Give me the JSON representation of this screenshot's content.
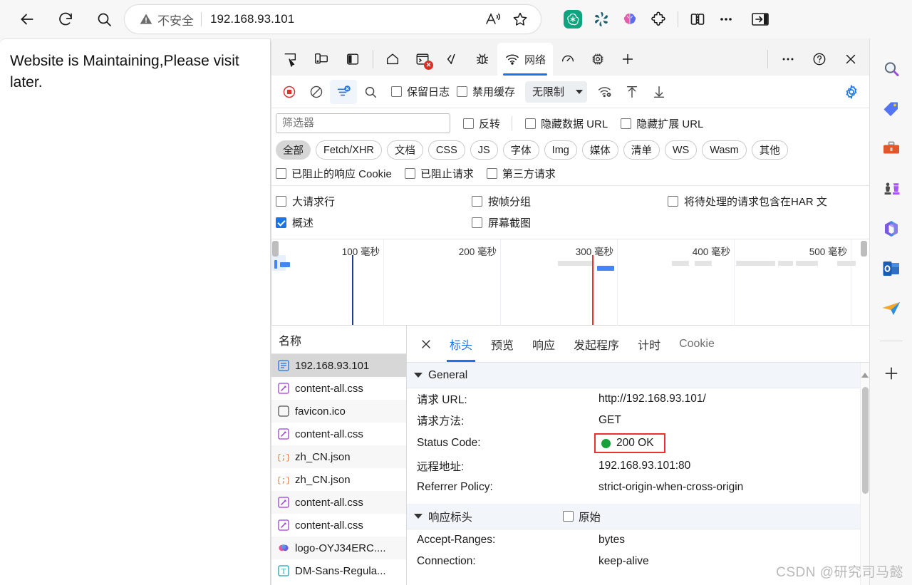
{
  "browser": {
    "nav": {
      "back": "back-arrow",
      "reload": "reload",
      "search": "search"
    },
    "omnibox": {
      "warning_label": "不安全",
      "url": "192.168.93.101",
      "read_aloud": "read-aloud",
      "favorite": "favorite-star"
    },
    "extensions": [
      "chatgpt",
      "openai",
      "brain-ai",
      "extensions-puzzle",
      "split-screen",
      "more-options",
      "collections-open"
    ]
  },
  "page": {
    "text": "Website is Maintaining,Please visit later."
  },
  "devtools": {
    "tools": [
      "inspect-element",
      "device-toolbar",
      "dock-side"
    ],
    "tabs": [
      {
        "label": "",
        "icon": "home-icon",
        "active": false
      },
      {
        "label": "",
        "icon": "console-icon",
        "active": false,
        "error_badge": "x"
      },
      {
        "label": "",
        "icon": "sources-icon",
        "active": false
      },
      {
        "label": "",
        "icon": "elements-bug-icon",
        "active": false
      },
      {
        "label": "网络",
        "icon": "network-icon",
        "active": true
      },
      {
        "label": "",
        "icon": "performance-icon",
        "active": false
      },
      {
        "label": "",
        "icon": "memory-chip-icon",
        "active": false
      },
      {
        "label": "",
        "icon": "add-panel-icon",
        "active": false
      }
    ],
    "tab_right": [
      "more-tools",
      "help",
      "close-devtools"
    ],
    "network_toolbar": {
      "record_label": "record-stop-button",
      "clear_label": "clear-button",
      "filter_label": "filter-toggle",
      "search_label": "search-button",
      "preserve_log": {
        "label": "保留日志",
        "checked": false
      },
      "disable_cache": {
        "label": "禁用缓存",
        "checked": false
      },
      "throttle": {
        "value": "无限制"
      },
      "network_conditions": "network-conditions-icon",
      "import_har": "import-har-icon",
      "export_har": "export-har-icon",
      "settings": "settings-gear-icon"
    },
    "filter": {
      "placeholder": "筛选器",
      "value": "",
      "invert": {
        "label": "反转",
        "checked": false
      },
      "hide_data_urls": {
        "label": "隐藏数据 URL",
        "checked": false
      },
      "hide_ext_urls": {
        "label": "隐藏扩展 URL",
        "checked": false
      },
      "types": [
        "全部",
        "Fetch/XHR",
        "文档",
        "CSS",
        "JS",
        "字体",
        "Img",
        "媒体",
        "清单",
        "WS",
        "Wasm",
        "其他"
      ],
      "active_type": "全部",
      "blocked_cookies": {
        "label": "已阻止的响应 Cookie",
        "checked": false
      },
      "blocked_requests": {
        "label": "已阻止请求",
        "checked": false
      },
      "third_party": {
        "label": "第三方请求",
        "checked": false
      }
    },
    "settings_rows": [
      {
        "label": "大请求行",
        "checked": false
      },
      {
        "label": "按帧分组",
        "checked": false
      },
      {
        "label": "将待处理的请求包含在HAR 文",
        "checked": false
      },
      {
        "label": "概述",
        "checked": true
      },
      {
        "label": "屏幕截图",
        "checked": false
      }
    ],
    "overview": {
      "ticks": [
        "100 毫秒",
        "200 毫秒",
        "300 毫秒",
        "400 毫秒",
        "500 毫秒"
      ]
    },
    "requests": {
      "column_header": "名称",
      "rows": [
        {
          "name": "192.168.93.101",
          "icon": "document-icon",
          "selected": true
        },
        {
          "name": "content-all.css",
          "icon": "stylesheet-icon",
          "selected": false
        },
        {
          "name": "favicon.ico",
          "icon": "generic-file-icon",
          "selected": false
        },
        {
          "name": "content-all.css",
          "icon": "stylesheet-icon",
          "selected": false
        },
        {
          "name": "zh_CN.json",
          "icon": "json-icon",
          "selected": false
        },
        {
          "name": "zh_CN.json",
          "icon": "json-icon",
          "selected": false
        },
        {
          "name": "content-all.css",
          "icon": "stylesheet-icon",
          "selected": false
        },
        {
          "name": "content-all.css",
          "icon": "stylesheet-icon",
          "selected": false
        },
        {
          "name": "logo-OYJ34ERC....",
          "icon": "image-icon",
          "selected": false
        },
        {
          "name": "DM-Sans-Regula...",
          "icon": "font-icon",
          "selected": false
        }
      ]
    },
    "detail": {
      "tabs": [
        "标头",
        "预览",
        "响应",
        "发起程序",
        "计时",
        "Cookie"
      ],
      "active_tab": "标头",
      "sections": [
        {
          "title": "General",
          "rows": [
            {
              "key": "请求 URL:",
              "value": "http://192.168.93.101/"
            },
            {
              "key": "请求方法:",
              "value": "GET"
            },
            {
              "key": "Status Code:",
              "value": "200 OK",
              "highlight": true,
              "status_dot": "#18a03a"
            },
            {
              "key": "远程地址:",
              "value": "192.168.93.101:80"
            },
            {
              "key": "Referrer Policy:",
              "value": "strict-origin-when-cross-origin"
            }
          ]
        },
        {
          "title": "响应标头",
          "raw_label": "原始",
          "raw_checked": false,
          "rows": [
            {
              "key": "Accept-Ranges:",
              "value": "bytes"
            },
            {
              "key": "Connection:",
              "value": "keep-alive"
            }
          ]
        }
      ]
    }
  },
  "edgebar": {
    "items": [
      "search-icon",
      "price-tag-icon",
      "tools-briefcase-icon",
      "games-chess-icon",
      "microsoft365-icon",
      "outlook-icon",
      "telegram-plane-icon"
    ],
    "add_label": "add-sidebar-app"
  },
  "watermark": "CSDN @研究司马懿",
  "colors": {
    "accent": "#1a73e8",
    "danger": "#d93025",
    "success": "#18a03a",
    "highlight_border": "#f03030"
  }
}
